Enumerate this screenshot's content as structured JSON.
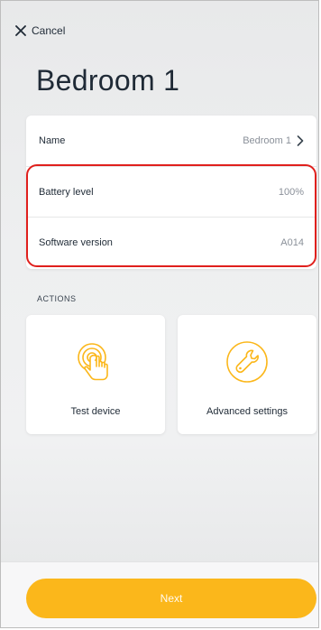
{
  "header": {
    "cancel_label": "Cancel",
    "page_title": "Bedroom 1"
  },
  "info": {
    "name_label": "Name",
    "name_value": "Bedroom 1",
    "battery_label": "Battery level",
    "battery_value": "100%",
    "software_label": "Software version",
    "software_value": "A014"
  },
  "actions": {
    "section_label": "ACTIONS",
    "test_label": "Test device",
    "advanced_label": "Advanced settings"
  },
  "footer": {
    "next_label": "Next"
  },
  "colors": {
    "accent": "#fbb71b",
    "highlight": "#e0201d",
    "text": "#1f2a36",
    "muted": "#8a9099"
  },
  "icons": {
    "cancel": "close-icon",
    "name_row": "chevron-right-icon",
    "test": "touch-hand-icon",
    "advanced": "wrench-icon"
  }
}
